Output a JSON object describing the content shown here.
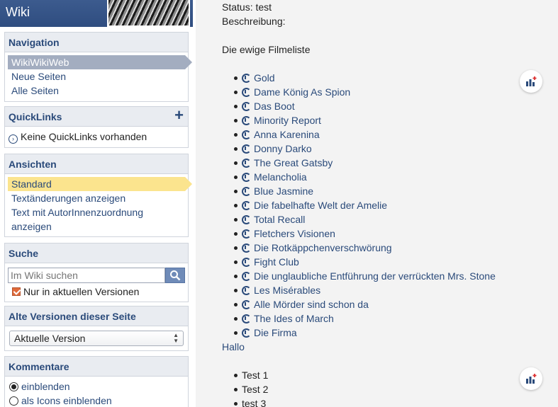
{
  "header": {
    "title": "Wiki"
  },
  "navigation": {
    "title": "Navigation",
    "items": [
      {
        "label": "WikiWikiWeb"
      },
      {
        "label": "Neue Seiten"
      },
      {
        "label": "Alle Seiten"
      }
    ]
  },
  "quicklinks": {
    "title": "QuickLinks",
    "add_icon": "plus-icon",
    "empty_text": "Keine QuickLinks vorhanden"
  },
  "views": {
    "title": "Ansichten",
    "items": [
      {
        "label": "Standard"
      },
      {
        "label": "Textänderungen anzeigen"
      },
      {
        "label": "Text mit AutorInnenzuordnung anzeigen"
      }
    ]
  },
  "search": {
    "title": "Suche",
    "placeholder": "Im Wiki suchen",
    "checkbox_label": "Nur in aktuellen Versionen"
  },
  "versions": {
    "title": "Alte Versionen dieser Seite",
    "selected": "Aktuelle Version"
  },
  "comments": {
    "title": "Kommentare",
    "options": [
      {
        "label": "einblenden",
        "checked": true
      },
      {
        "label": "als Icons einblenden",
        "checked": false
      }
    ]
  },
  "main": {
    "status": "Status: test",
    "description_label": "Beschreibung:",
    "list_title": "Die ewige Filmeliste",
    "films": [
      "Gold",
      "Dame König As Spion",
      "Das Boot",
      "Minority Report",
      "Anna Karenina",
      "Donny Darko",
      "The Great Gatsby",
      "Melancholia",
      "Blue Jasmine",
      "Die fabelhafte Welt der Amelie",
      "Total Recall",
      "Fletchers Visionen",
      "Die Rotkäppchenverschwörung",
      "Fight Club",
      "Die unglaubliche Entführung der verrückten Mrs. Stone",
      "Les Misérables",
      "Alle Mörder sind schon da",
      "The Ides of March",
      "Die Firma"
    ],
    "hallo_link": "Hallo",
    "tests": [
      "Test 1",
      "Test 2",
      "test 3"
    ]
  },
  "colors": {
    "accent": "#2a4a7a",
    "nav_selected": "#a3adc0",
    "view_selected": "#fbe48e",
    "header_bg": "#2f4d80"
  }
}
